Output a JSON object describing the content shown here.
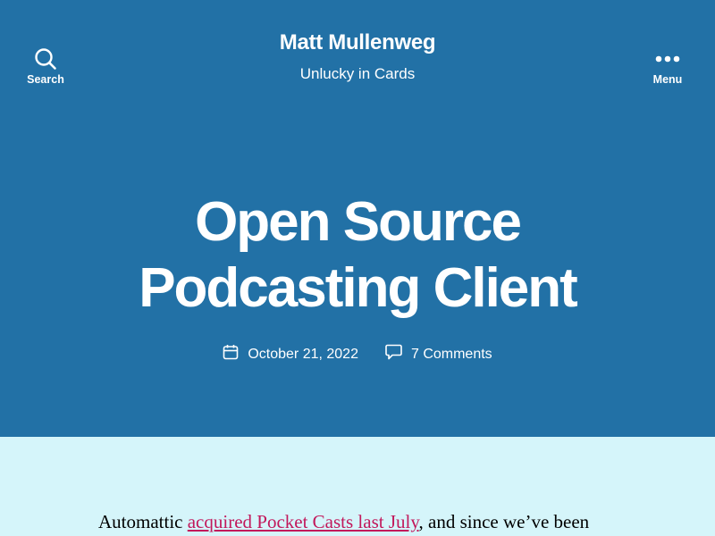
{
  "header": {
    "search_label": "Search",
    "menu_label": "Menu",
    "site_title": "Matt Mullenweg",
    "tagline": "Unlucky in Cards"
  },
  "post": {
    "title_line1": "Open Source",
    "title_line2": "Podcasting Client",
    "date": "October 21, 2022",
    "comments": "7 Comments"
  },
  "content": {
    "intro_prefix": "Automattic ",
    "intro_link": "acquired Pocket Casts last July",
    "intro_suffix": ", and since we’ve been"
  },
  "icons": {
    "search": "search-icon",
    "menu": "menu-dots-icon",
    "calendar": "calendar-icon",
    "comment": "comment-bubble-icon"
  },
  "colors": {
    "hero_background": "#2271a6",
    "content_background": "#d5f5fa",
    "link": "#c2185b",
    "hero_text": "#ffffff"
  }
}
